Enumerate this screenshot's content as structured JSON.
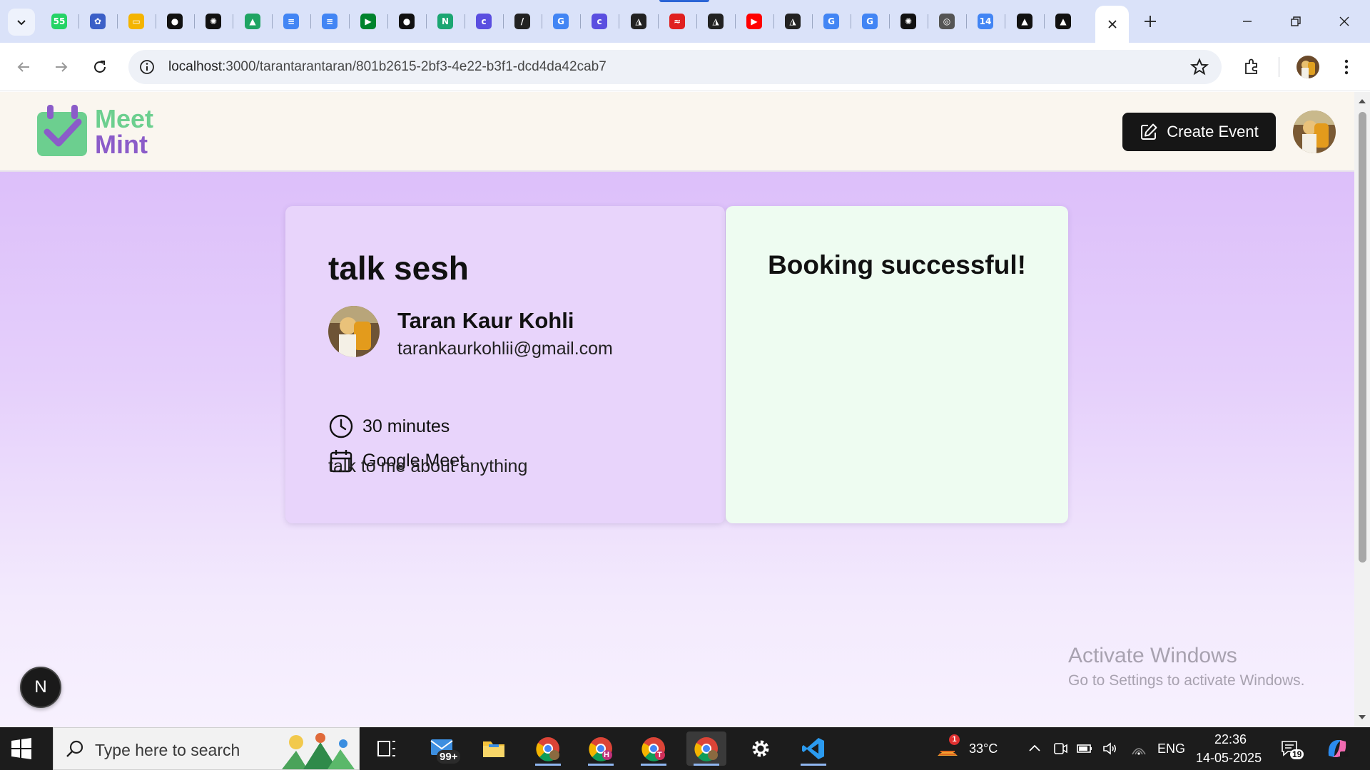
{
  "browser": {
    "tabs": [
      {
        "icon": "whatsapp-icon",
        "color": "#25d366",
        "glyph": "55"
      },
      {
        "icon": "butterfly-icon",
        "color": "#3b5fc7",
        "glyph": "✿"
      },
      {
        "icon": "slides-icon",
        "color": "#f4b400",
        "glyph": "▭"
      },
      {
        "icon": "mongodb-icon",
        "color": "#111111",
        "glyph": "●"
      },
      {
        "icon": "openai-icon",
        "color": "#111111",
        "glyph": "✺"
      },
      {
        "icon": "google-drive-icon",
        "color": "#1fa463",
        "glyph": "▲"
      },
      {
        "icon": "google-docs-icon",
        "color": "#4285f4",
        "glyph": "≡"
      },
      {
        "icon": "google-docs-icon",
        "color": "#4285f4",
        "glyph": "≡"
      },
      {
        "icon": "google-meet-icon",
        "color": "#00832d",
        "glyph": "▶"
      },
      {
        "icon": "github-icon",
        "color": "#111111",
        "glyph": "●"
      },
      {
        "icon": "notes-icon",
        "color": "#1ba672",
        "glyph": "N"
      },
      {
        "icon": "canva-icon",
        "color": "#5a4ee0",
        "glyph": "c"
      },
      {
        "icon": "pen-icon",
        "color": "#222222",
        "glyph": "/"
      },
      {
        "icon": "google-icon",
        "color": "#4285f4",
        "glyph": "G"
      },
      {
        "icon": "canva-icon",
        "color": "#5a4ee0",
        "glyph": "c"
      },
      {
        "icon": "vercel-like-icon",
        "color": "#222222",
        "glyph": "◮"
      },
      {
        "icon": "stripes-icon",
        "color": "#e02020",
        "glyph": "≈"
      },
      {
        "icon": "vercel-like-icon",
        "color": "#222222",
        "glyph": "◮"
      },
      {
        "icon": "youtube-icon",
        "color": "#ff0000",
        "glyph": "▶"
      },
      {
        "icon": "vercel-like-icon",
        "color": "#222222",
        "glyph": "◮"
      },
      {
        "icon": "google-icon",
        "color": "#4285f4",
        "glyph": "G"
      },
      {
        "icon": "google-icon",
        "color": "#4285f4",
        "glyph": "G"
      },
      {
        "icon": "openai-icon",
        "color": "#111111",
        "glyph": "✺"
      },
      {
        "icon": "chrome-icon",
        "color": "#555555",
        "glyph": "◎"
      },
      {
        "icon": "calendar-icon",
        "color": "#4285f4",
        "glyph": "14"
      },
      {
        "icon": "triangle-icon",
        "color": "#111111",
        "glyph": "▲"
      },
      {
        "icon": "triangle-icon",
        "color": "#111111",
        "glyph": "▲"
      }
    ],
    "url_host": "localhost",
    "url_path": ":3000/tarantarantaran/801b2615-2bf3-4e22-b3f1-dcd4da42cab7"
  },
  "site": {
    "logo_line1": "Meet",
    "logo_line2": "Mint",
    "create_event_label": "Create Event",
    "colors": {
      "logo_green": "#6ccf8f",
      "logo_purple": "#8b5cc9",
      "card_left": "#e8d4fb",
      "card_right": "#eefcf1"
    }
  },
  "event": {
    "title": "talk sesh",
    "host_name": "Taran Kaur Kohli",
    "host_email": "tarankaurkohlii@gmail.com",
    "duration": "30 minutes",
    "platform": "Google Meet",
    "description": "talk to me about anything"
  },
  "booking": {
    "status_text": "Booking successful!"
  },
  "overlay": {
    "next_badge": "N",
    "activate_title": "Activate Windows",
    "activate_sub": "Go to Settings to activate Windows."
  },
  "taskbar": {
    "search_placeholder": "Type here to search",
    "mail_badge": "99+",
    "weather_temp": "33°C",
    "weather_badge": "1",
    "language": "ENG",
    "time": "22:36",
    "date": "14-05-2025",
    "notification_count": "19",
    "chrome_profiles": [
      "",
      "H",
      "T",
      ""
    ]
  }
}
